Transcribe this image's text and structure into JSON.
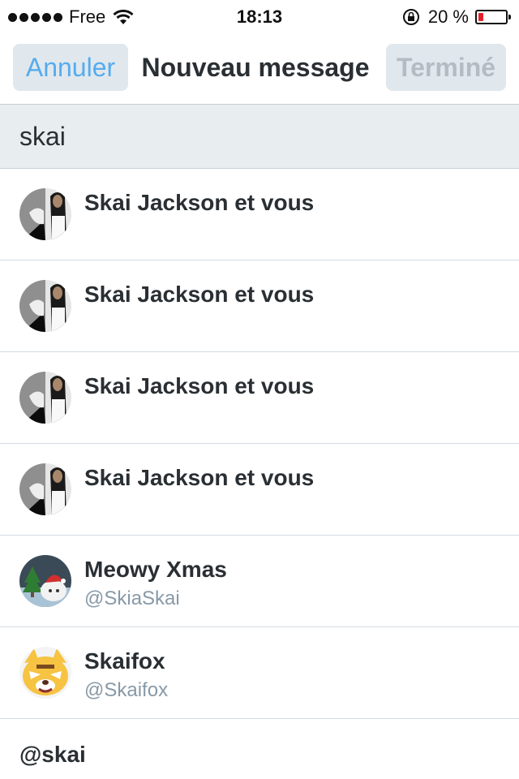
{
  "status_bar": {
    "carrier": "Free",
    "time": "18:13",
    "battery_percent_text": "20 %",
    "battery_level": 0.2,
    "colors": {
      "battery_low": "#e5202a"
    }
  },
  "nav": {
    "cancel_label": "Annuler",
    "title": "Nouveau message",
    "done_label": "Terminé",
    "colors": {
      "accent": "#55acee",
      "disabled": "#b3bcc3"
    }
  },
  "search": {
    "value": "skai"
  },
  "results": [
    {
      "name": "Skai Jackson et vous",
      "avatar": "group-avatar-split"
    },
    {
      "name": "Skai Jackson et vous",
      "avatar": "group-avatar-split"
    },
    {
      "name": "Skai Jackson et vous",
      "avatar": "group-avatar-split"
    },
    {
      "name": "Skai Jackson et vous",
      "avatar": "group-avatar-split"
    },
    {
      "name": "Meowy Xmas",
      "handle": "@SkiaSkai",
      "avatar": "cat-christmas-avatar"
    },
    {
      "name": "Skaifox",
      "handle": "@Skaifox",
      "avatar": "fox-cartoon-avatar"
    }
  ],
  "handle_suggestion": "@skai"
}
